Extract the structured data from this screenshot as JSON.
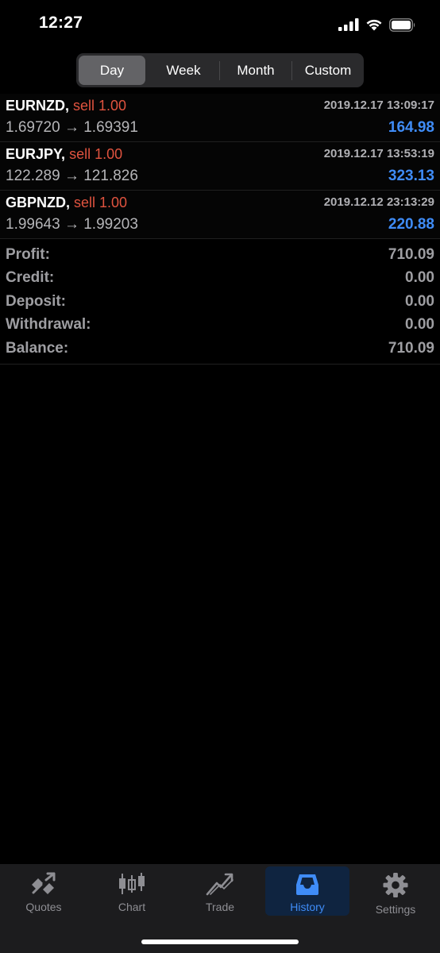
{
  "status_bar": {
    "time": "12:27"
  },
  "segments": [
    {
      "label": "Day",
      "active": true
    },
    {
      "label": "Week",
      "active": false
    },
    {
      "label": "Month",
      "active": false
    },
    {
      "label": "Custom",
      "active": false
    }
  ],
  "trades": [
    {
      "symbol": "EURNZD,",
      "side": "sell 1.00",
      "time": "2019.12.17 13:09:17",
      "prices": "1.69720 → 1.69391",
      "profit": "164.98"
    },
    {
      "symbol": "EURJPY,",
      "side": "sell 1.00",
      "time": "2019.12.17 13:53:19",
      "prices": "122.289 → 121.826",
      "profit": "323.13"
    },
    {
      "symbol": "GBPNZD,",
      "side": "sell 1.00",
      "time": "2019.12.12 23:13:29",
      "prices": "1.99643 → 1.99203",
      "profit": "220.88"
    }
  ],
  "summary": [
    {
      "label": "Profit:",
      "value": "710.09"
    },
    {
      "label": "Credit:",
      "value": "0.00"
    },
    {
      "label": "Deposit:",
      "value": "0.00"
    },
    {
      "label": "Withdrawal:",
      "value": "0.00"
    },
    {
      "label": "Balance:",
      "value": "710.09"
    }
  ],
  "tabs": [
    {
      "label": "Quotes",
      "icon": "quotes-icon",
      "active": false
    },
    {
      "label": "Chart",
      "icon": "candlestick-chart-icon",
      "active": false
    },
    {
      "label": "Trade",
      "icon": "trade-icon",
      "active": false
    },
    {
      "label": "History",
      "icon": "inbox-tray-icon",
      "active": true
    },
    {
      "label": "Settings",
      "icon": "gear-icon",
      "active": false
    }
  ],
  "colors": {
    "accent": "#3f8cf7",
    "sell": "#e0533f",
    "background": "#000000"
  }
}
